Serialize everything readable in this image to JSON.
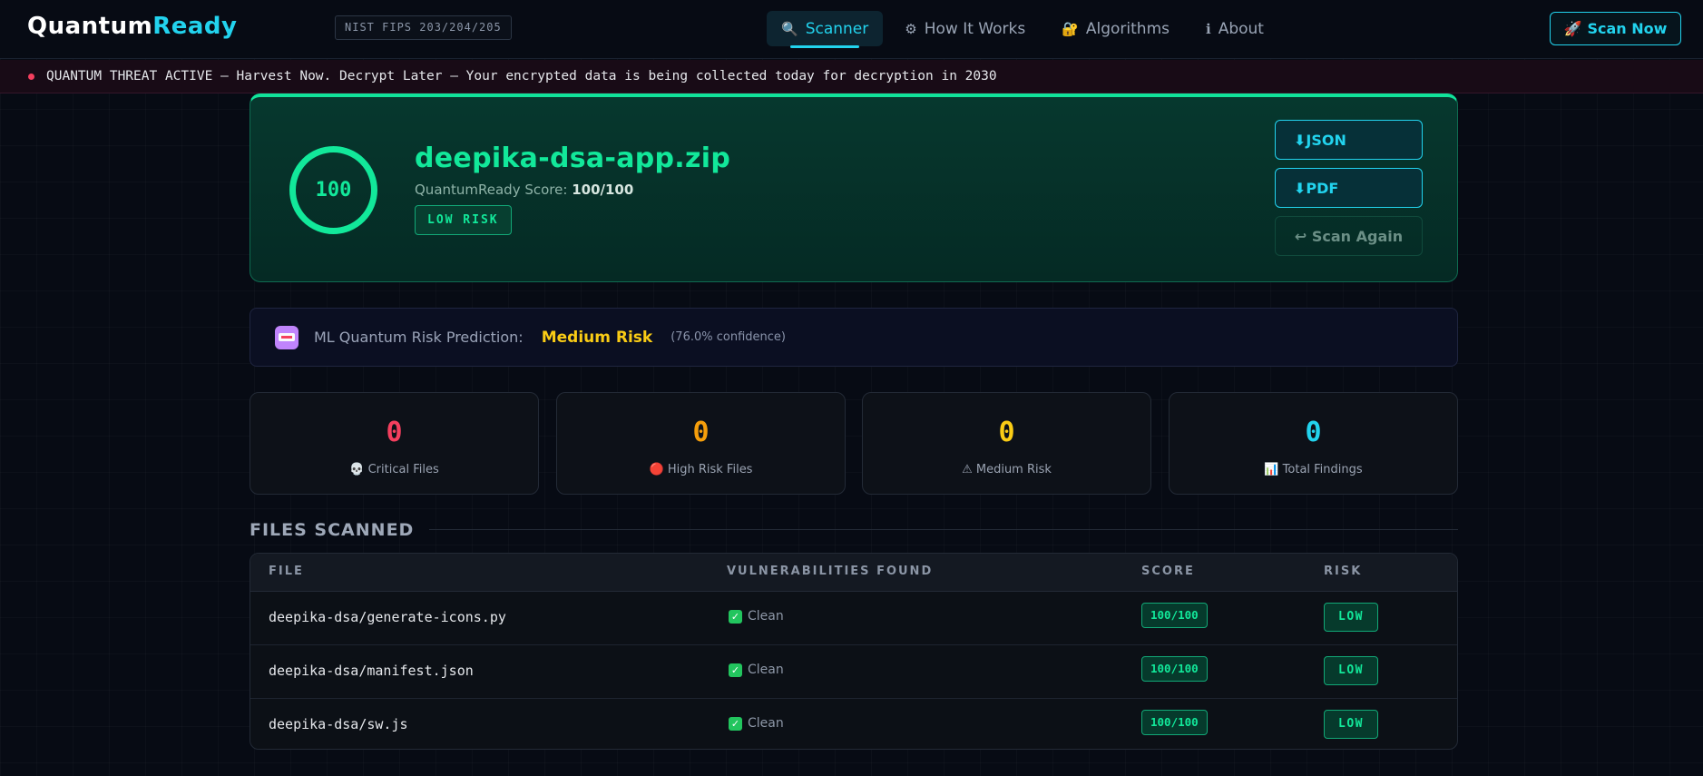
{
  "nav": {
    "logo_main": "Quantum",
    "logo_accent": "Ready",
    "fips_badge": "NIST FIPS 203/204/205",
    "links": [
      {
        "icon": "🔍",
        "label": "Scanner"
      },
      {
        "icon": "⚙",
        "label": "How It Works"
      },
      {
        "icon": "🔐",
        "label": "Algorithms"
      },
      {
        "icon": "ℹ",
        "label": "About"
      }
    ],
    "cta_icon": "🚀",
    "cta_label": "Scan Now"
  },
  "threat_banner": {
    "text": "QUANTUM THREAT ACTIVE — Harvest Now. Decrypt Later — Your encrypted data is being collected today for decryption in 2030"
  },
  "result": {
    "score_ring": "100",
    "filename": "deepika-dsa-app.zip",
    "score_label": "QuantumReady Score:",
    "score_value": "100/100",
    "risk_badge": "LOW RISK",
    "actions": {
      "json": "⬇JSON",
      "pdf": "⬇PDF",
      "again": "↩ Scan Again"
    }
  },
  "ml_prediction": {
    "label": "ML Quantum Risk Prediction:",
    "value": "Medium Risk",
    "confidence": "(76.0% confidence)"
  },
  "stats": [
    {
      "value": "0",
      "icon": "💀",
      "label": "Critical Files",
      "color": "#f43f5e"
    },
    {
      "value": "0",
      "icon": "🔴",
      "label": "High Risk Files",
      "color": "#f59e0b"
    },
    {
      "value": "0",
      "icon": "⚠",
      "label": "Medium Risk",
      "color": "#facc15"
    },
    {
      "value": "0",
      "icon": "📊",
      "label": "Total Findings",
      "color": "#22d3ee"
    }
  ],
  "files_section": {
    "title": "FILES SCANNED",
    "columns": [
      "FILE",
      "VULNERABILITIES FOUND",
      "SCORE",
      "RISK"
    ],
    "rows": [
      {
        "file": "deepika-dsa/generate-icons.py",
        "vulns": "Clean",
        "score": "100/100",
        "risk": "LOW"
      },
      {
        "file": "deepika-dsa/manifest.json",
        "vulns": "Clean",
        "score": "100/100",
        "risk": "LOW"
      },
      {
        "file": "deepika-dsa/sw.js",
        "vulns": "Clean",
        "score": "100/100",
        "risk": "LOW"
      }
    ]
  },
  "colors": {
    "accent": "#22d3ee",
    "success": "#12e89a",
    "warning": "#facc15",
    "danger": "#f43f5e"
  }
}
